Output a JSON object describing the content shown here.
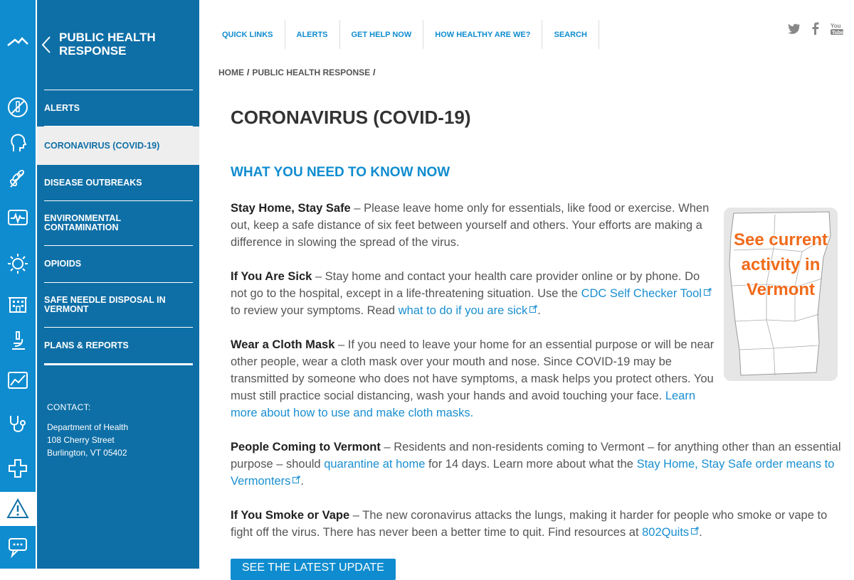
{
  "sidebar": {
    "title": "PUBLIC HEALTH RESPONSE",
    "items": [
      {
        "label": "ALERTS"
      },
      {
        "label": "CORONAVIRUS (COVID-19)"
      },
      {
        "label": "DISEASE OUTBREAKS"
      },
      {
        "label": "ENVIRONMENTAL CONTAMINATION"
      },
      {
        "label": "OPIOIDS"
      },
      {
        "label": "SAFE NEEDLE DISPOSAL IN VERMONT"
      },
      {
        "label": "PLANS & REPORTS"
      }
    ],
    "contact": {
      "label": "CONTACT:",
      "org": "Department of Health",
      "street": "108 Cherry Street",
      "city": "Burlington, VT 05402"
    }
  },
  "rail": {
    "icons": [
      "mountain-logo-icon",
      "no-smoking-icon",
      "head-profile-icon",
      "wheat-icon",
      "heart-monitor-icon",
      "sun-icon",
      "building-icon",
      "microscope-icon",
      "chart-icon",
      "stethoscope-icon",
      "plus-icon"
    ],
    "bottom": [
      "alert-triangle-icon",
      "chat-icon"
    ]
  },
  "topnav": {
    "items": [
      "QUICK LINKS",
      "ALERTS",
      "GET HELP NOW",
      "HOW HEALTHY ARE WE?",
      "SEARCH"
    ]
  },
  "social": [
    "twitter-icon",
    "facebook-icon",
    "youtube-icon"
  ],
  "breadcrumb": {
    "home": "HOME",
    "section": "PUBLIC HEALTH RESPONSE",
    "sep": "/"
  },
  "main": {
    "title": "CORONAVIRUS (COVID-19)",
    "subtitle": "WHAT YOU NEED TO KNOW NOW",
    "p1_bold": "Stay Home, Stay Safe",
    "p1_text": " – Please leave home only for essentials, like food or exercise. When out, keep a safe distance of six feet between yourself and others. Your efforts are making a difference in slowing the spread of the virus.",
    "p2_bold": "If You Are Sick",
    "p2_text": " – Stay home and contact your health care provider online or by phone. Do not go to the hospital, except in a life-threatening situation. Use the ",
    "p2_link1": "CDC Self Checker Tool",
    "p2_mid": " to review your symptoms. Read ",
    "p2_link2": "what to do if you are sick",
    "p2_end": ".",
    "p3_bold": "Wear a Cloth Mask",
    "p3_text": " – If you need to leave your home for an essential purpose or will be near other people, wear a cloth mask over your mouth and nose. Since COVID-19 may be transmitted by someone who does not have symptoms, a mask helps you protect others. You must still practice social distancing, wash your hands and avoid touching your face. ",
    "p3_link": "Learn more about how to use and make cloth masks.",
    "p4_bold": "People Coming to Vermont",
    "p4_text": " – Residents and non-residents coming to Vermont – for anything other than an essential purpose – should ",
    "p4_link1": "quarantine at home",
    "p4_mid": " for 14 days. Learn more about what the ",
    "p4_link2": "Stay Home, Stay Safe order means to Vermonters",
    "p4_end": ".",
    "p5_bold": "If You Smoke or Vape",
    "p5_text": " – The new coronavirus attacks the lungs, making it harder for people who smoke or vape to fight off the virus. There has never been a better time to quit. Find resources at ",
    "p5_link": "802Quits",
    "p5_end": ".",
    "cta": "SEE THE LATEST UPDATE",
    "map_text": "See current activity in Vermont"
  },
  "colors": {
    "primary": "#0f8ccf",
    "sidebar": "#0e6fa6",
    "accent": "#f06a1a"
  }
}
